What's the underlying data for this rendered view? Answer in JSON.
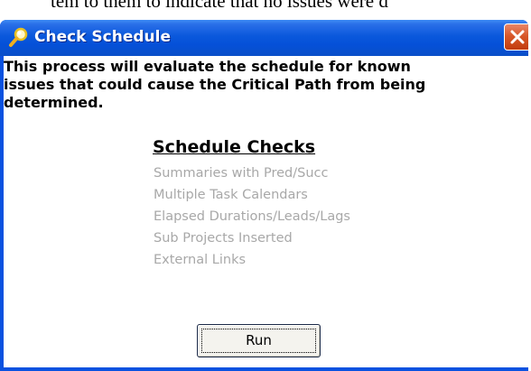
{
  "background_text": "tem to them to indicate that no issues were d",
  "window": {
    "title": "Check Schedule",
    "icons": {
      "title": "magnifier-icon",
      "close": "close-icon"
    }
  },
  "content": {
    "description": "This process will evaluate the schedule for known\nissues that could cause the Critical Path from being\ndetermined.",
    "checks_heading": "Schedule Checks",
    "checks": [
      "Summaries with Pred/Succ",
      "Multiple Task Calendars",
      "Elapsed Durations/Leads/Lags",
      "Sub Projects Inserted",
      "External Links"
    ],
    "run_label": "Run"
  },
  "colors": {
    "titlebar": "#0a58dc",
    "close_button": "#d8582a",
    "disabled_text": "#a8a8a8",
    "client_bg": "#ffffff"
  }
}
